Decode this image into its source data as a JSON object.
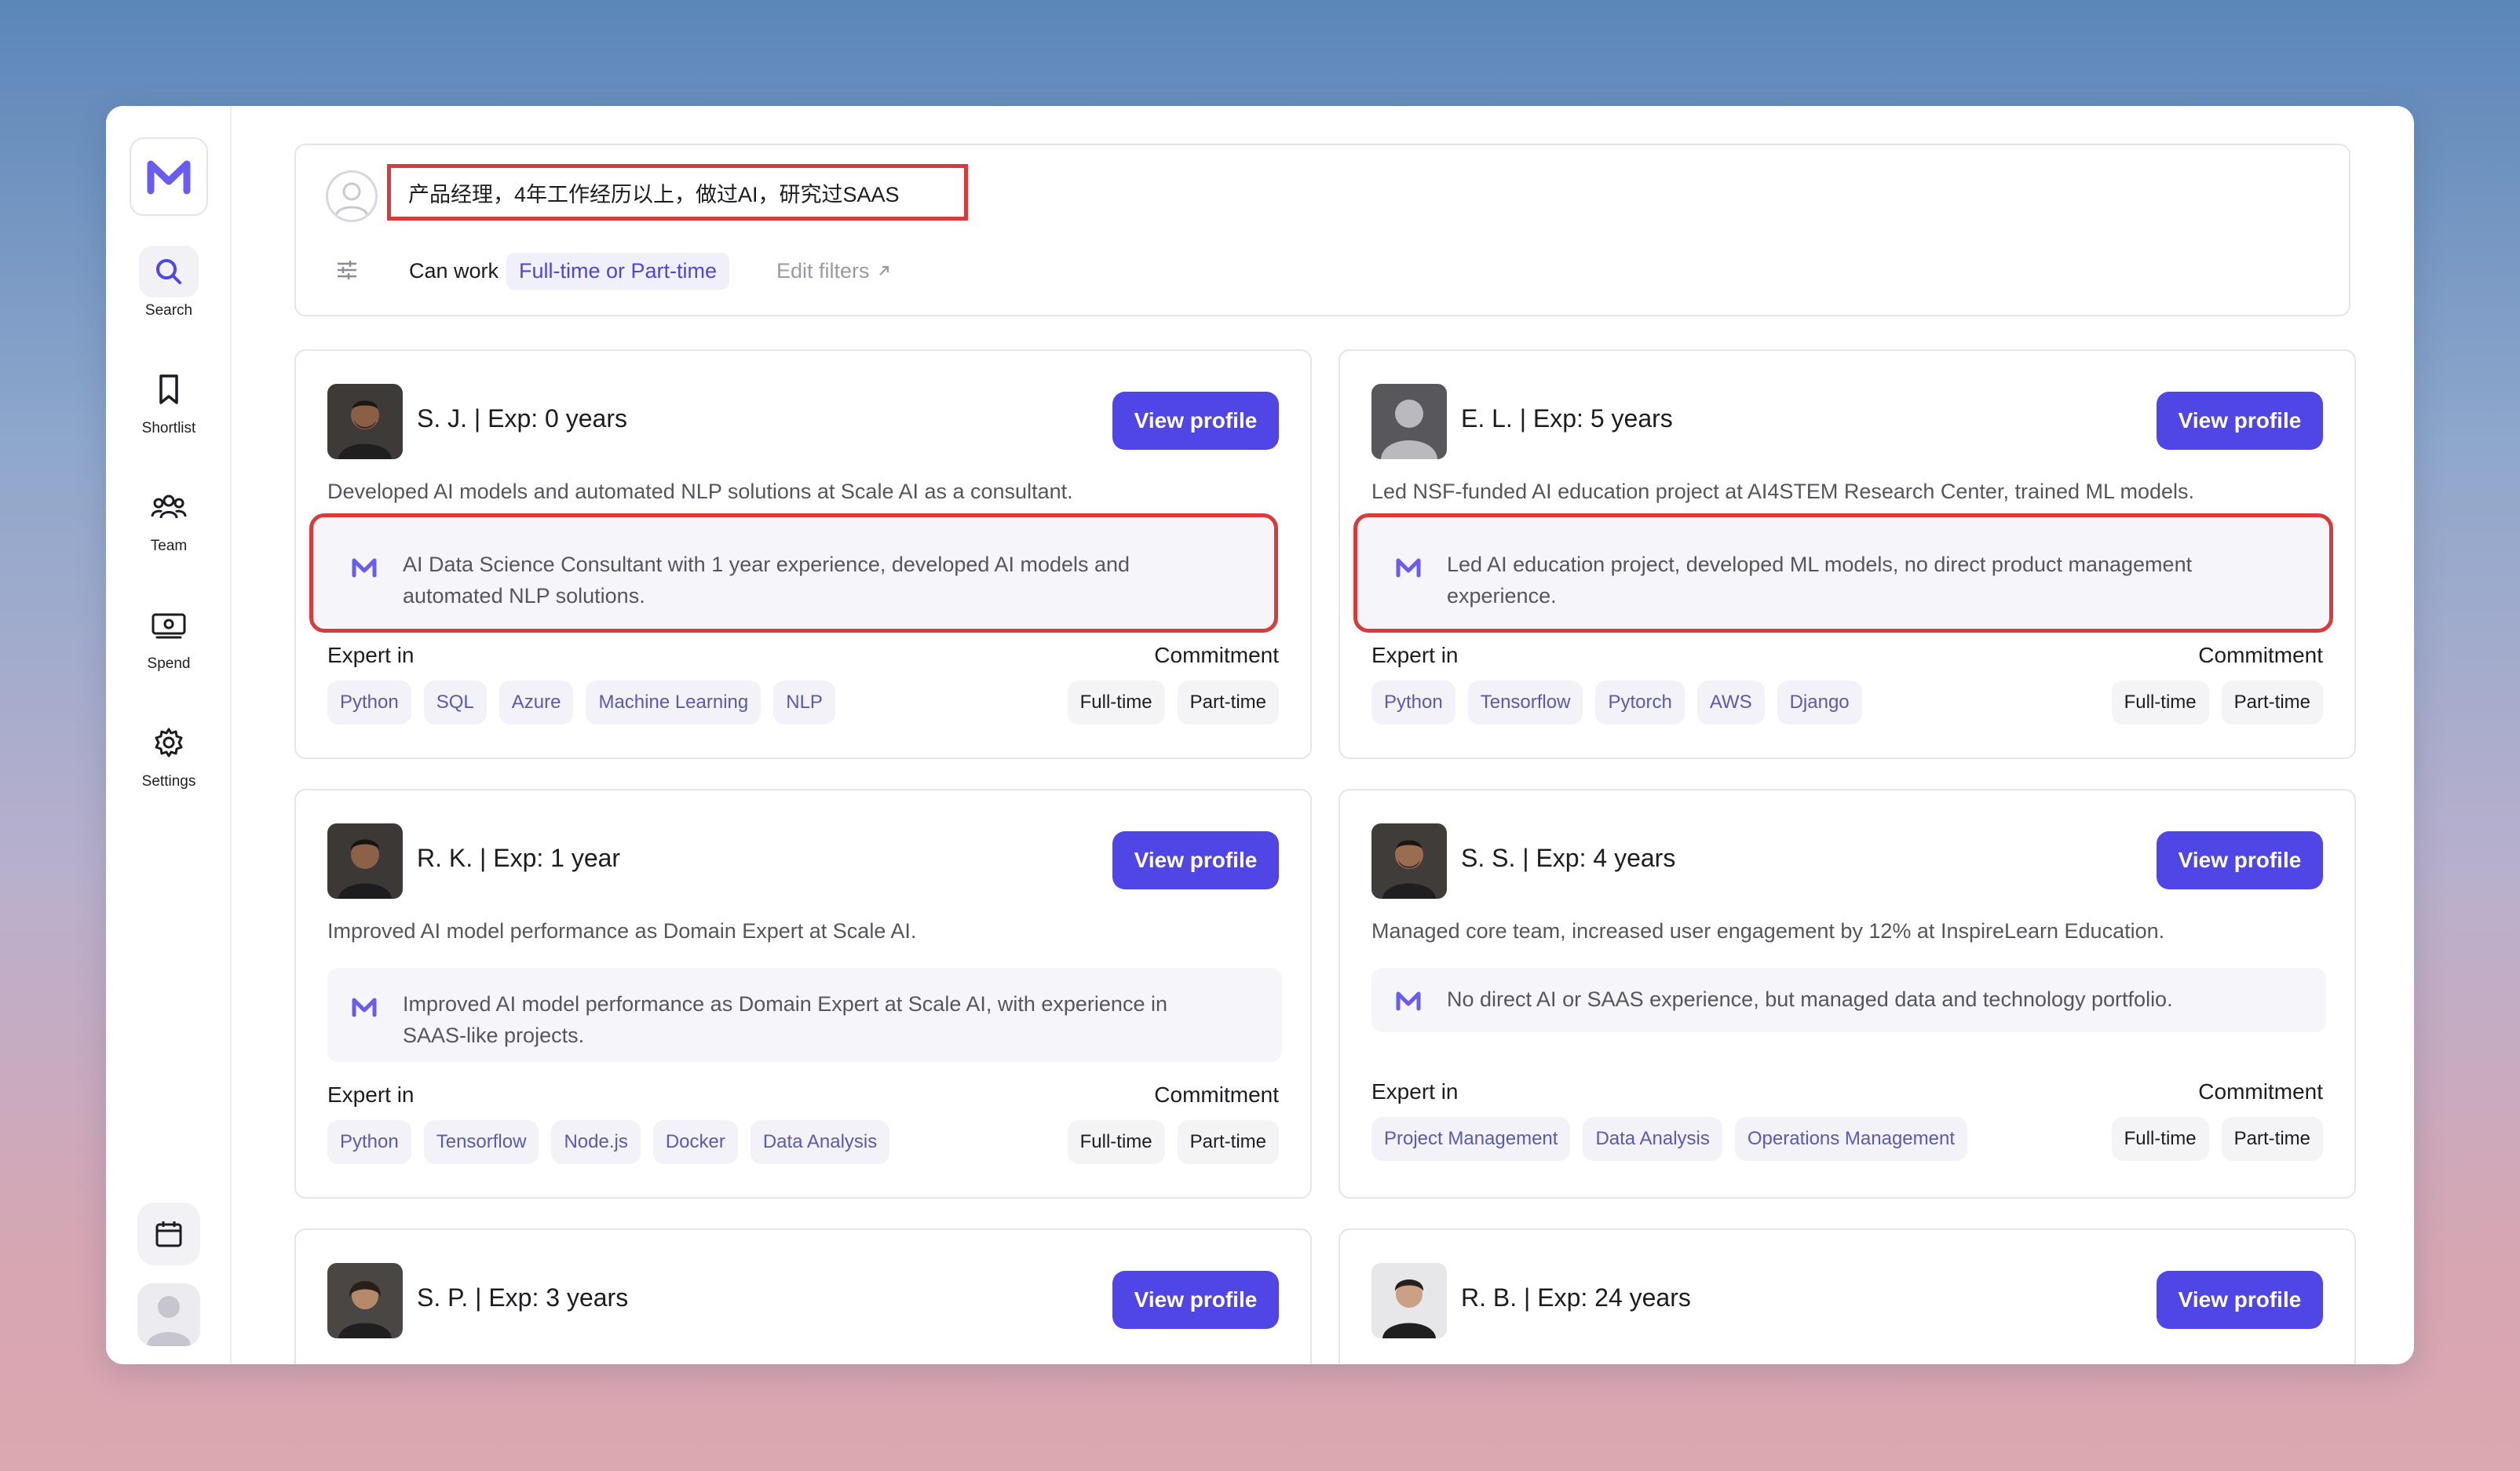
{
  "sidebar": {
    "items": [
      {
        "label": "Search",
        "icon": "search-icon"
      },
      {
        "label": "Shortlist",
        "icon": "bookmark-icon"
      },
      {
        "label": "Team",
        "icon": "team-icon"
      },
      {
        "label": "Spend",
        "icon": "money-icon"
      },
      {
        "label": "Settings",
        "icon": "gear-icon"
      }
    ]
  },
  "search": {
    "query": "产品经理，4年工作经历以上，做过AI，研究过SAAS",
    "can_work_label": "Can work",
    "can_work_value": "Full-time or Part-time",
    "edit_filters": "Edit filters"
  },
  "view_profile_label": "View profile",
  "expert_in_label": "Expert in",
  "commitment_label": "Commitment",
  "candidates": [
    {
      "name": "S. J.",
      "exp": "Exp: 0 years",
      "desc": "Developed AI models and automated NLP solutions at Scale AI as a consultant.",
      "ai_summary": "AI Data Science Consultant with 1 year experience, developed AI models and automated NLP solutions.",
      "skills": [
        "Python",
        "SQL",
        "Azure",
        "Machine Learning",
        "NLP"
      ],
      "commitment": [
        "Full-time",
        "Part-time"
      ]
    },
    {
      "name": "E. L.",
      "exp": "Exp: 5 years",
      "desc": "Led NSF-funded AI education project at AI4STEM Research Center, trained ML models.",
      "ai_summary": "Led AI education project, developed ML models, no direct product management experience.",
      "skills": [
        "Python",
        "Tensorflow",
        "Pytorch",
        "AWS",
        "Django"
      ],
      "commitment": [
        "Full-time",
        "Part-time"
      ]
    },
    {
      "name": "R. K.",
      "exp": "Exp: 1 year",
      "desc": "Improved AI model performance as Domain Expert at Scale AI.",
      "ai_summary": "Improved AI model performance as Domain Expert at Scale AI, with experience in SAAS-like projects.",
      "skills": [
        "Python",
        "Tensorflow",
        "Node.js",
        "Docker",
        "Data Analysis"
      ],
      "commitment": [
        "Full-time",
        "Part-time"
      ]
    },
    {
      "name": "S. S.",
      "exp": "Exp: 4 years",
      "desc": "Managed core team, increased user engagement by 12% at InspireLearn Education.",
      "ai_summary": "No direct AI or SAAS experience, but managed data and technology portfolio.",
      "skills": [
        "Project Management",
        "Data Analysis",
        "Operations Management"
      ],
      "commitment": [
        "Full-time",
        "Part-time"
      ]
    },
    {
      "name": "S. P.",
      "exp": "Exp: 3 years"
    },
    {
      "name": "R. B.",
      "exp": "Exp: 24 years"
    }
  ],
  "colors": {
    "accent": "#4f46e5",
    "highlight": "#d93a3a"
  }
}
